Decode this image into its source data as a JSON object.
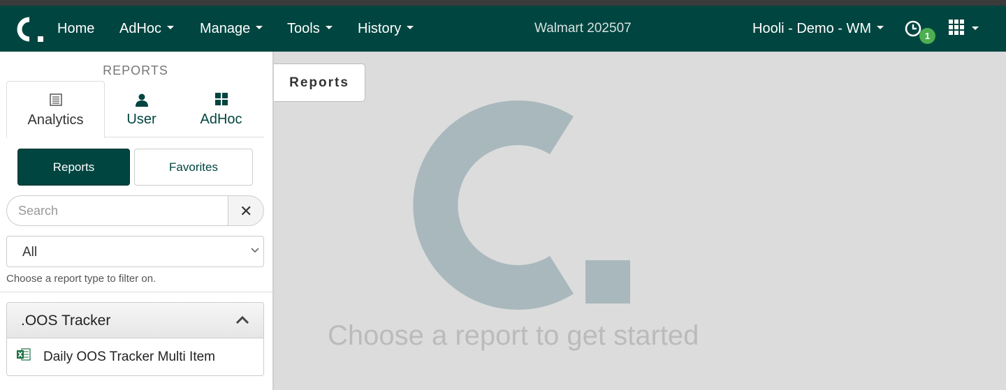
{
  "nav": {
    "logo": "C.",
    "items": [
      {
        "label": "Home"
      },
      {
        "label": "AdHoc"
      },
      {
        "label": "Manage"
      },
      {
        "label": "Tools"
      },
      {
        "label": "History"
      }
    ],
    "center_title": "Walmart 202507",
    "account": "Hooli - Demo - WM",
    "notification_count": "1",
    "icons": {
      "history": "clock-icon",
      "apps": "grid-icon"
    }
  },
  "sidebar": {
    "title": "REPORTS",
    "tabs": [
      {
        "label": "Analytics",
        "icon": "list-icon"
      },
      {
        "label": "User",
        "icon": "user-icon"
      },
      {
        "label": "AdHoc",
        "icon": "grid-icon"
      }
    ],
    "buttons": {
      "reports": "Reports",
      "favorites": "Favorites"
    },
    "search": {
      "placeholder": "Search",
      "value": ""
    },
    "filter": {
      "selected": "All",
      "help": "Choose a report type to filter on."
    },
    "group": {
      "title": ".OOS Tracker",
      "items": [
        {
          "label": "Daily OOS Tracker Multi Item",
          "icon": "excel-icon"
        }
      ]
    }
  },
  "main": {
    "tab_label": "Reports",
    "prompt": "Choose a report to get started"
  },
  "colors": {
    "brand": "#004540",
    "badge": "#4caf50",
    "watermark": "#a9b8bc"
  }
}
